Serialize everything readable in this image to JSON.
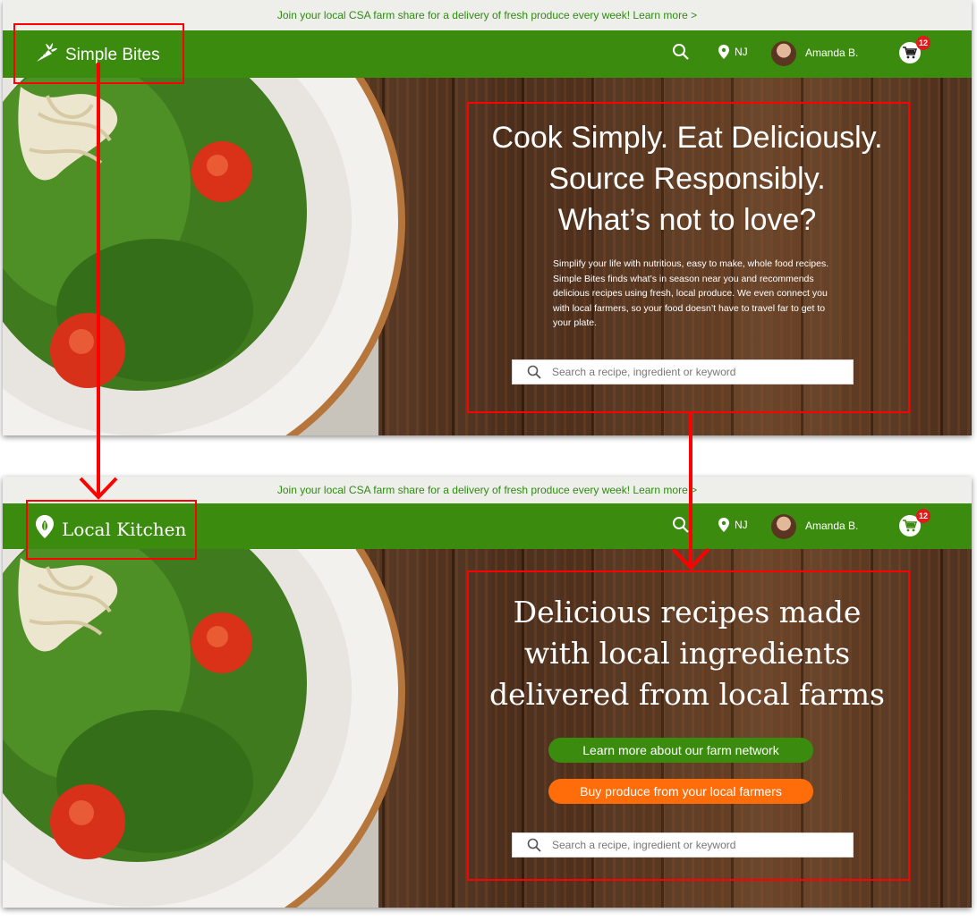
{
  "screens": [
    {
      "banner": {
        "text": "Join your local CSA farm share for a delivery of fresh produce every week!",
        "link": "Learn more >"
      },
      "brand": {
        "name": "Simple Bites",
        "icon": "carrot-icon"
      },
      "nav": {
        "search_icon": "search-icon",
        "location": "NJ",
        "user_name": "Amanda B.",
        "cart_count": "12"
      },
      "hero": {
        "title": "Cook Simply. Eat Deliciously.\nSource Responsibly.\nWhat’s not to love?",
        "description": "Simplify your life with nutritious, easy to make, whole food recipes. Simple Bites finds what’s in season near you and recommends delicious recipes using fresh, local produce. We even connect you with local farmers, so your food doesn’t have to travel far to get to your plate.",
        "search_placeholder": "Search a recipe, ingredient or keyword"
      }
    },
    {
      "banner": {
        "text": "Join your local CSA farm share for a delivery of fresh produce every week!",
        "link": "Learn more >"
      },
      "brand": {
        "name": "Local Kitchen",
        "icon": "map-pin-leaf-icon"
      },
      "nav": {
        "search_icon": "search-icon",
        "location": "NJ",
        "user_name": "Amanda B.",
        "cart_count": "12"
      },
      "hero": {
        "title": "Delicious recipes made\nwith local ingredients\ndelivered from local farms",
        "cta_primary": "Learn more about our farm network",
        "cta_secondary": "Buy produce from your local farmers",
        "search_placeholder": "Search a recipe, ingredient or keyword"
      }
    }
  ],
  "colors": {
    "brand_green": "#3b8c0e",
    "cta_orange": "#ff6d0a",
    "annotation_red": "#ff0000",
    "badge_red": "#e01b1b"
  }
}
